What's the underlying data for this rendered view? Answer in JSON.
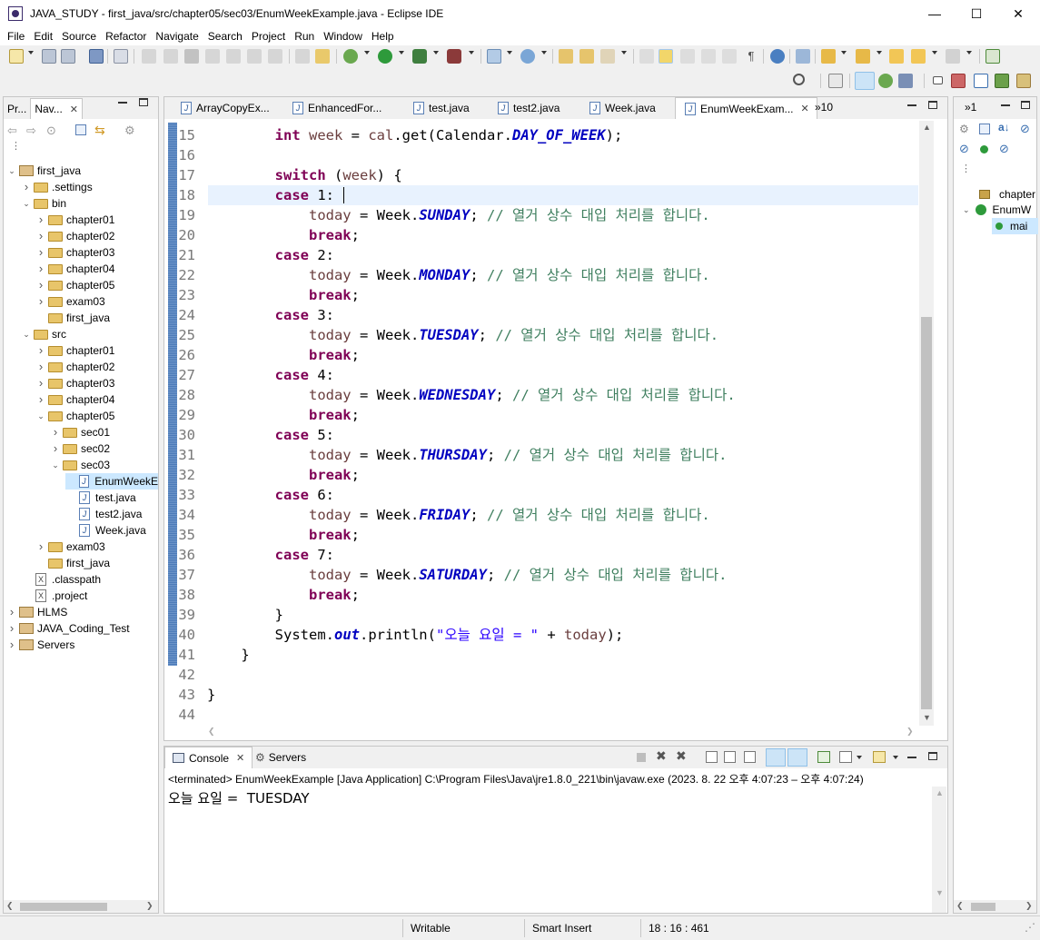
{
  "window": {
    "title": "JAVA_STUDY - first_java/src/chapter05/sec03/EnumWeekExample.java - Eclipse IDE",
    "minimize": "—",
    "maximize": "☐",
    "close": "✕"
  },
  "menu": [
    "File",
    "Edit",
    "Source",
    "Refactor",
    "Navigate",
    "Search",
    "Project",
    "Run",
    "Window",
    "Help"
  ],
  "left_panel": {
    "tabs": [
      "Pr...",
      "Nav..."
    ],
    "tree": [
      {
        "label": "first_java",
        "type": "project",
        "expanded": true
      },
      {
        "label": ".settings",
        "type": "folder"
      },
      {
        "label": "bin",
        "type": "folder",
        "expanded": true
      },
      {
        "label": "chapter01",
        "type": "folder"
      },
      {
        "label": "chapter02",
        "type": "folder"
      },
      {
        "label": "chapter03",
        "type": "folder"
      },
      {
        "label": "chapter04",
        "type": "folder"
      },
      {
        "label": "chapter05",
        "type": "folder"
      },
      {
        "label": "exam03",
        "type": "folder"
      },
      {
        "label": "first_java",
        "type": "folder"
      },
      {
        "label": "src",
        "type": "folder",
        "expanded": true
      },
      {
        "label": "chapter01",
        "type": "folder"
      },
      {
        "label": "chapter02",
        "type": "folder"
      },
      {
        "label": "chapter03",
        "type": "folder"
      },
      {
        "label": "chapter04",
        "type": "folder"
      },
      {
        "label": "chapter05",
        "type": "folder",
        "expanded": true
      },
      {
        "label": "sec01",
        "type": "folder"
      },
      {
        "label": "sec02",
        "type": "folder"
      },
      {
        "label": "sec03",
        "type": "folder",
        "expanded": true
      },
      {
        "label": "EnumWeekE",
        "type": "java",
        "selected": true
      },
      {
        "label": "test.java",
        "type": "java"
      },
      {
        "label": "test2.java",
        "type": "java"
      },
      {
        "label": "Week.java",
        "type": "java"
      },
      {
        "label": "exam03",
        "type": "folder"
      },
      {
        "label": "first_java",
        "type": "folder"
      },
      {
        "label": ".classpath",
        "type": "xml"
      },
      {
        "label": ".project",
        "type": "xml"
      },
      {
        "label": "HLMS",
        "type": "project"
      },
      {
        "label": "JAVA_Coding_Test",
        "type": "project"
      },
      {
        "label": "Servers",
        "type": "project"
      }
    ]
  },
  "editor": {
    "tabs": [
      "ArrayCopyEx...",
      "EnhancedFor...",
      "test.java",
      "test2.java",
      "Week.java",
      "EnumWeekExam..."
    ],
    "overflow": "»10",
    "line_numbers": [
      "15",
      "16",
      "17",
      "18",
      "19",
      "20",
      "21",
      "22",
      "23",
      "24",
      "25",
      "26",
      "27",
      "28",
      "29",
      "30",
      "31",
      "32",
      "33",
      "34",
      "35",
      "36",
      "37",
      "38",
      "39",
      "40",
      "41",
      "42",
      "43",
      "44"
    ],
    "comment": "// 열거 상수 대입 처리를 합니다.",
    "line15": {
      "kw": "int",
      "mid": " week = cal.get(Calendar.",
      "fld": "DAY_OF_WEEK",
      "end": ");"
    },
    "switch_kw": "switch",
    "switch_rest": " (week) {",
    "case_kw": "case",
    "cases": [
      {
        "label": " 1:",
        "const": "SUNDAY"
      },
      {
        "label": " 2:",
        "const": "MONDAY"
      },
      {
        "label": " 3:",
        "const": "TUESDAY"
      },
      {
        "label": " 4:",
        "const": "WEDNESDAY"
      },
      {
        "label": " 5:",
        "const": "THURSDAY"
      },
      {
        "label": " 6:",
        "const": "FRIDAY"
      },
      {
        "label": " 7:",
        "const": "SATURDAY"
      }
    ],
    "today_prefix": "today = Week.",
    "semi": "; ",
    "break_kw": "break",
    "break_semi": ";",
    "close_brace": "}",
    "println_pre": "System.",
    "println_out": "out",
    "println_mid": ".println(",
    "println_str": "\"오늘 요일 = \"",
    "println_end": " + today);"
  },
  "right_panel": {
    "overflow": "»1",
    "items": [
      "chapter",
      "EnumW",
      "mai"
    ]
  },
  "console": {
    "tabs": [
      "Console",
      "Servers"
    ],
    "status": "<terminated> EnumWeekExample [Java Application] C:\\Program Files\\Java\\jre1.8.0_221\\bin\\javaw.exe  (2023. 8. 22 오후 4:07:23 – 오후 4:07:24)",
    "output": "오늘 요일 =  TUESDAY"
  },
  "statusbar": {
    "writable": "Writable",
    "insert_mode": "Smart Insert",
    "position": "18 : 16 : 461"
  }
}
